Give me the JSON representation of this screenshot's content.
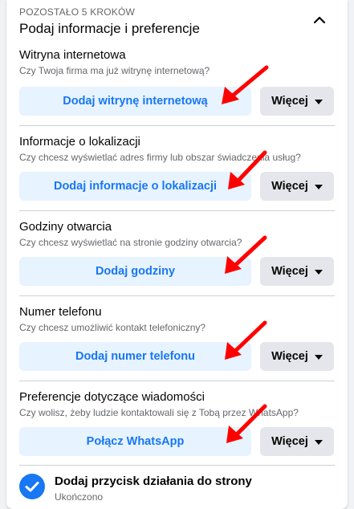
{
  "header": {
    "steps_left": "POZOSTAŁO 5 KROKÓW",
    "title": "Podaj informacje i preferencje"
  },
  "sections": [
    {
      "title": "Witryna internetowa",
      "subtitle": "Czy Twoja firma ma już witrynę internetową?",
      "primary": "Dodaj witrynę internetową",
      "more": "Więcej"
    },
    {
      "title": "Informacje o lokalizacji",
      "subtitle": "Czy chcesz wyświetlać adres firmy lub obszar świadczenia usług?",
      "primary": "Dodaj informacje o lokalizacji",
      "more": "Więcej"
    },
    {
      "title": "Godziny otwarcia",
      "subtitle": "Czy chcesz wyświetlać na stronie godziny otwarcia?",
      "primary": "Dodaj godziny",
      "more": "Więcej"
    },
    {
      "title": "Numer telefonu",
      "subtitle": "Czy chcesz umożliwić kontakt telefoniczny?",
      "primary": "Dodaj numer telefonu",
      "more": "Więcej"
    },
    {
      "title": "Preferencje dotyczące wiadomości",
      "subtitle": "Czy wolisz, żeby ludzie kontaktowali się z Tobą przez WhatsApp?",
      "primary": "Połącz WhatsApp",
      "more": "Więcej"
    }
  ],
  "completed": {
    "title": "Dodaj przycisk działania do strony",
    "status": "Ukończono"
  },
  "icons": {
    "collapse": "chevron-up-icon",
    "more_caret": "caret-down-icon",
    "completed": "checkmark-circle-icon",
    "annotation": "red-arrow-icon"
  },
  "colors": {
    "accent": "#1877f2",
    "primary_button_bg": "#e7f3ff",
    "secondary_button_bg": "#e4e6eb",
    "annotation_arrow": "#ff0000"
  }
}
